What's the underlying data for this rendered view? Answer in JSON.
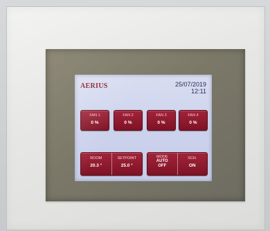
{
  "header": {
    "logo": "AERIUS",
    "date": "25/07/2019",
    "time": "12:11"
  },
  "fans": [
    {
      "label": "FAN 1",
      "value": "0 %"
    },
    {
      "label": "FAN 2",
      "value": "0 %"
    },
    {
      "label": "FAN 3",
      "value": "0 %"
    },
    {
      "label": "FAN 4",
      "value": "0 %"
    }
  ],
  "climate": {
    "room_label": "ROOM",
    "room_value": "20.3 °",
    "setpoint_label": "SETPOINT",
    "setpoint_value": "25.0 °"
  },
  "control": {
    "mode_label": "MODE",
    "mode_value": "AUTO",
    "mode_state": "OFF",
    "schedule_label": "SCH.",
    "schedule_value": "ON"
  },
  "colors": {
    "button": "#8f1a2e",
    "screen": "#ccd2ec",
    "logo": "#8a1522",
    "bezel": "#7b7868"
  }
}
